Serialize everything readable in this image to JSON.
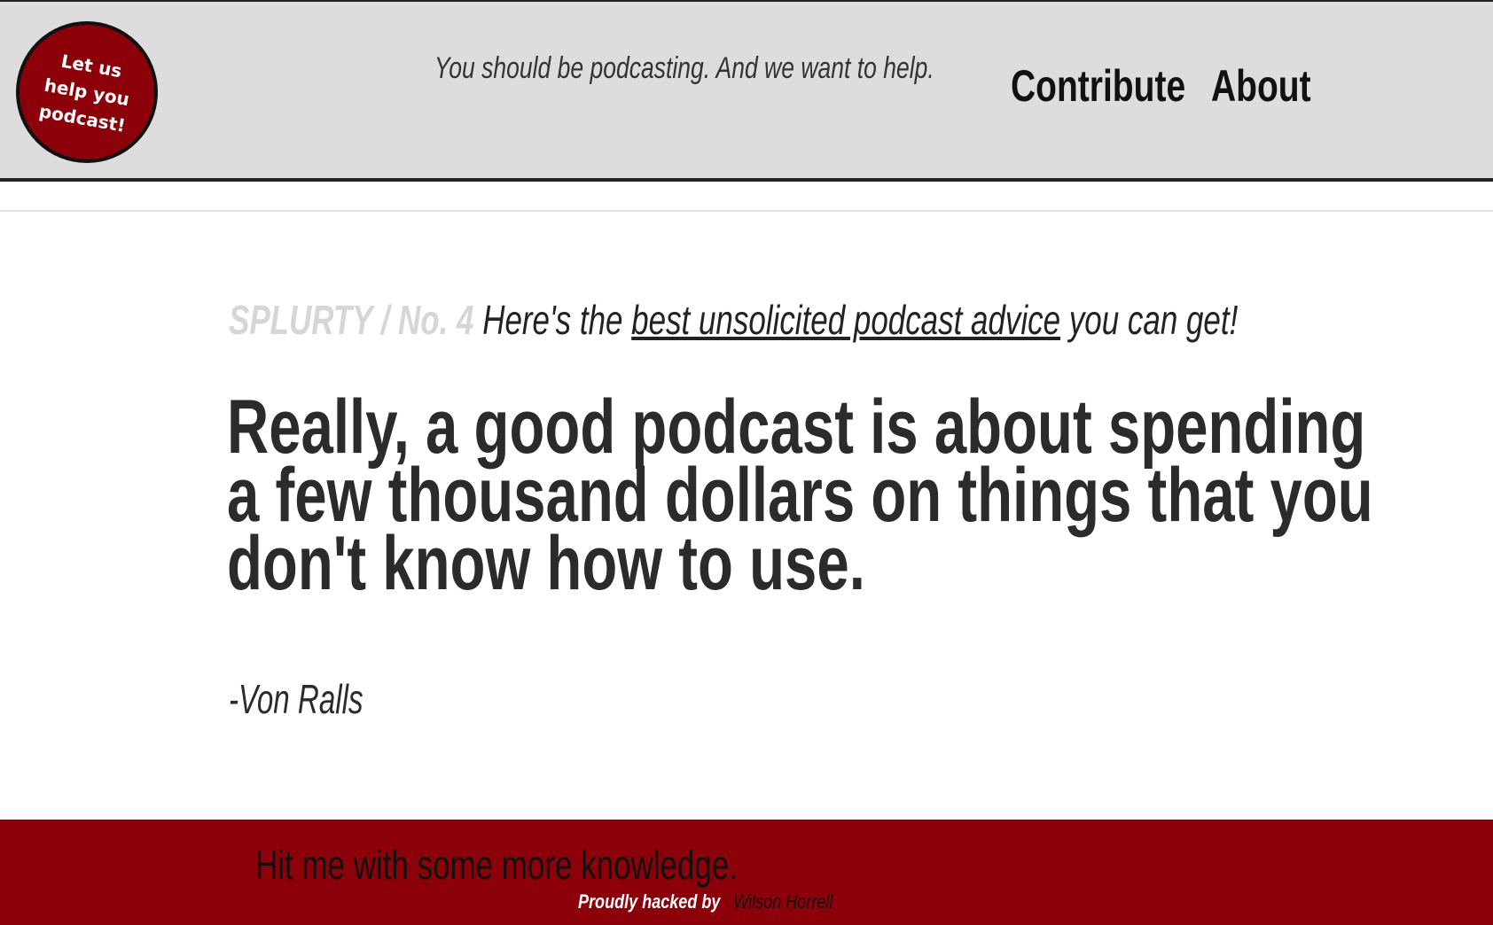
{
  "header": {
    "badge": {
      "line1": "Let us",
      "line2": "help you",
      "line3": "podcast!"
    },
    "tagline": "You should be podcasting. And we want to help.",
    "nav": {
      "contribute": "Contribute",
      "about": "About"
    }
  },
  "main": {
    "issue_label": "SPLURTY / No. 4",
    "intro_before": "Here's the",
    "intro_link": "best unsolicited podcast advice",
    "intro_after": "you can get!",
    "quote": "Really, a good podcast is about spending a few thousand dollars on things that you don't know how to use.",
    "attribution": "-Von Ralls"
  },
  "footer": {
    "more_link": "Hit me with some more knowledge.",
    "credit_prefix": "Proudly hacked by",
    "credit_name": "Wilson Horrell"
  },
  "colors": {
    "header_bg": "#dddddd",
    "brand_red": "#8b0009",
    "text_dark": "#2b2b2b",
    "issue_gray": "#d6d6d6"
  }
}
